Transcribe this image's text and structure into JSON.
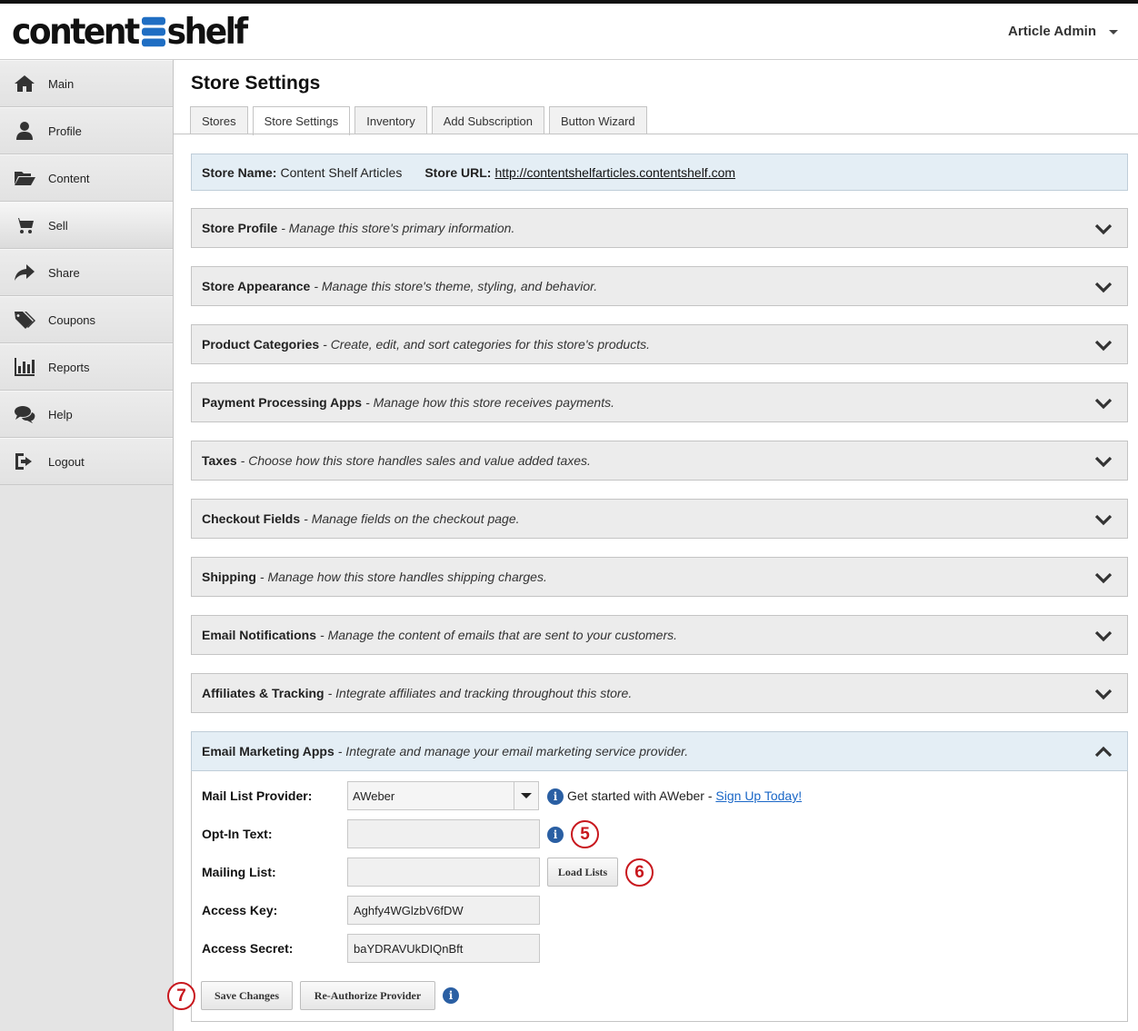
{
  "brand": {
    "logo_left": "content",
    "logo_right": "shelf"
  },
  "header": {
    "user_menu_label": "Article Admin"
  },
  "sidebar": {
    "items": [
      {
        "label": "Main",
        "icon": "home-icon"
      },
      {
        "label": "Profile",
        "icon": "user-icon"
      },
      {
        "label": "Content",
        "icon": "folder-open-icon"
      },
      {
        "label": "Sell",
        "icon": "cart-icon"
      },
      {
        "label": "Share",
        "icon": "share-icon"
      },
      {
        "label": "Coupons",
        "icon": "tags-icon"
      },
      {
        "label": "Reports",
        "icon": "bar-chart-icon"
      },
      {
        "label": "Help",
        "icon": "chat-bubbles-icon"
      },
      {
        "label": "Logout",
        "icon": "logout-icon"
      }
    ],
    "active_item": "Sell"
  },
  "main": {
    "title": "Store Settings",
    "tabs": [
      {
        "label": "Stores"
      },
      {
        "label": "Store Settings"
      },
      {
        "label": "Inventory"
      },
      {
        "label": "Add Subscription"
      },
      {
        "label": "Button Wizard"
      }
    ],
    "active_tab": "Store Settings",
    "store_info": {
      "name_label": "Store Name:",
      "name_value": "Content Shelf Articles",
      "url_label": "Store URL:",
      "url_value": "http://contentshelfarticles.contentshelf.com"
    },
    "sections": [
      {
        "title": "Store Profile",
        "desc": "- Manage this store's primary information."
      },
      {
        "title": "Store Appearance",
        "desc": "- Manage this store's theme, styling, and behavior."
      },
      {
        "title": "Product Categories",
        "desc": "- Create, edit, and sort categories for this store's products."
      },
      {
        "title": "Payment Processing Apps",
        "desc": "- Manage how this store receives payments."
      },
      {
        "title": "Taxes",
        "desc": "- Choose how this store handles sales and value added taxes."
      },
      {
        "title": "Checkout Fields",
        "desc": "- Manage fields on the checkout page."
      },
      {
        "title": "Shipping",
        "desc": "- Manage how this store handles shipping charges."
      },
      {
        "title": "Email Notifications",
        "desc": "- Manage the content of emails that are sent to your customers."
      },
      {
        "title": "Affiliates & Tracking",
        "desc": "- Integrate affiliates and tracking throughout this store."
      },
      {
        "title": "Email Marketing Apps",
        "desc": "- Integrate and manage your email marketing service provider.",
        "expanded": true
      }
    ],
    "email_marketing": {
      "provider_label": "Mail List Provider:",
      "provider_value": "AWeber",
      "provider_note": "Get started with AWeber -",
      "provider_link": "Sign Up Today!",
      "optin_label": "Opt-In Text:",
      "optin_value": "",
      "mailing_list_label": "Mailing List:",
      "mailing_list_value": "",
      "load_lists_button": "Load Lists",
      "access_key_label": "Access Key:",
      "access_key_value": "Aghfy4WGlzbV6fDW",
      "access_secret_label": "Access Secret:",
      "access_secret_value": "baYDRAVUkDIQnBft",
      "save_button": "Save Changes",
      "reauthorize_button": "Re-Authorize Provider"
    },
    "callouts": [
      "5",
      "6",
      "7"
    ]
  },
  "colors": {
    "accent": "#1f6ec3",
    "info_icon": "#2a5fa3",
    "callout": "#c8181e",
    "link": "#1a67c7"
  }
}
